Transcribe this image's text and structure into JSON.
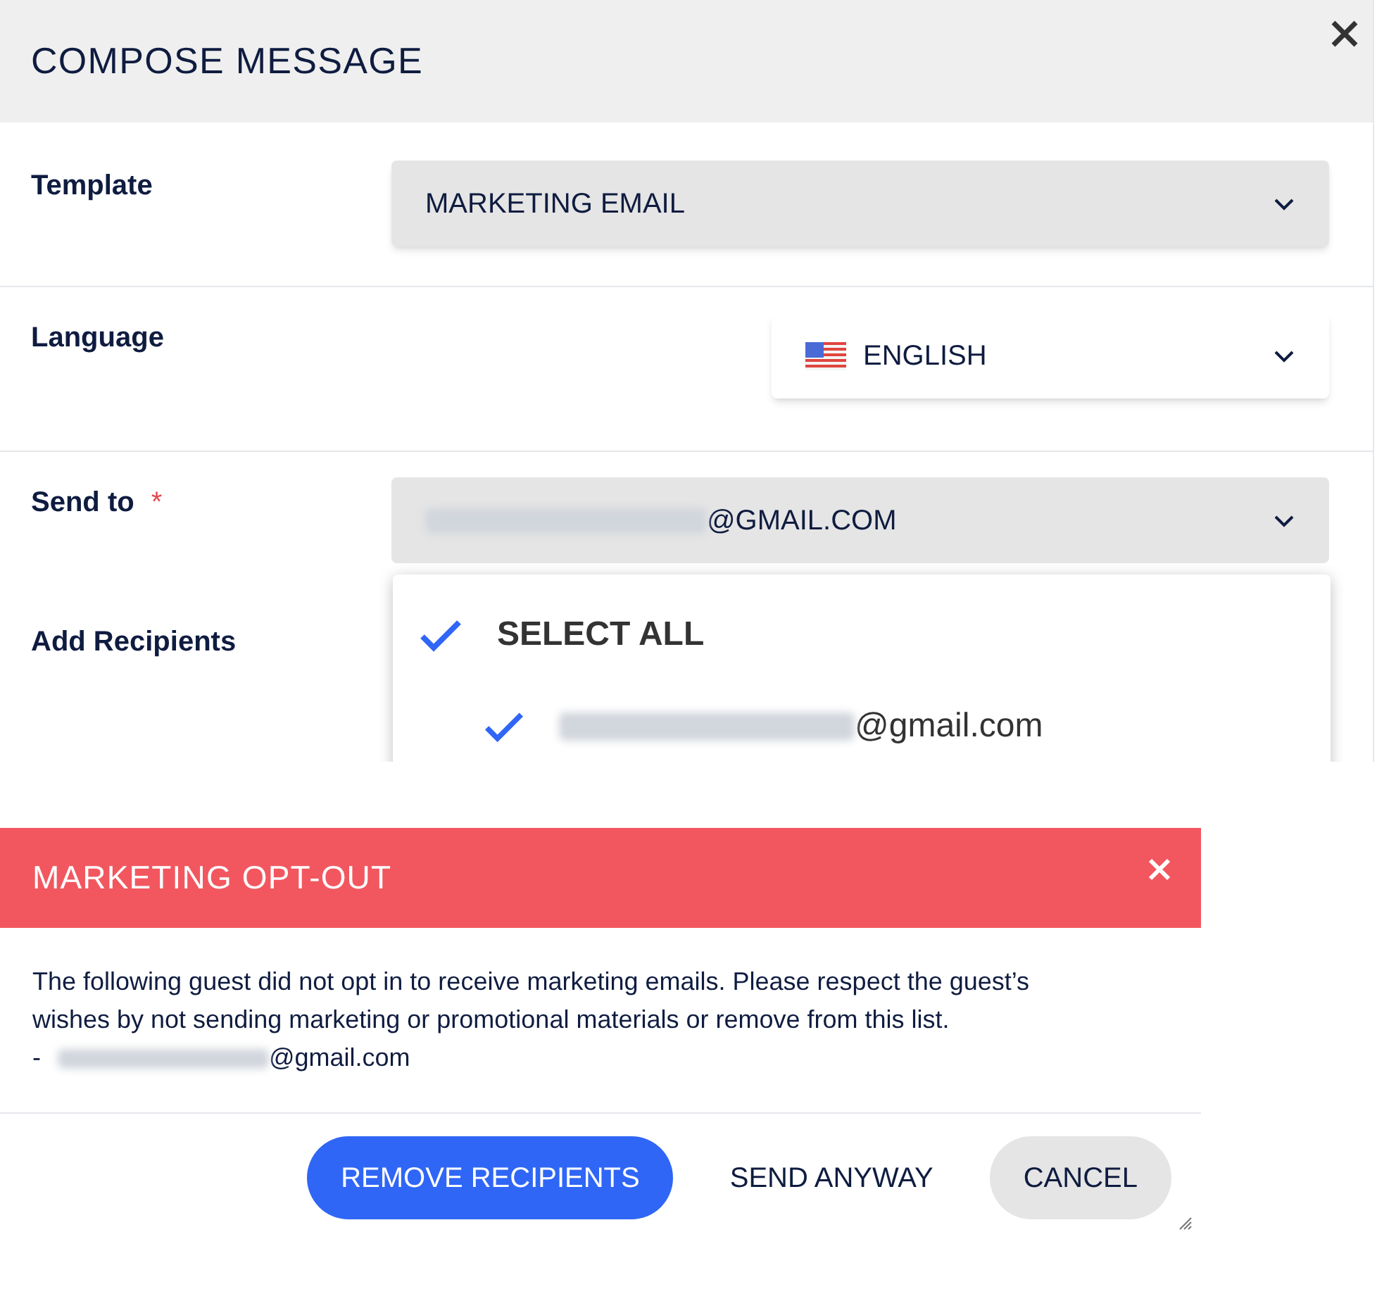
{
  "compose": {
    "title": "COMPOSE MESSAGE",
    "fields": [
      {
        "label": "Template",
        "kind": "select",
        "value": "MARKETING EMAIL"
      },
      {
        "label": "Language",
        "kind": "language",
        "value": "ENGLISH"
      },
      {
        "label": "Send to",
        "kind": "recipients",
        "required": true,
        "required_mark": "*",
        "value": "@GMAIL.COM",
        "redacted": true
      }
    ],
    "add_recipients_label": "Add Recipients",
    "dropdown": [
      {
        "label": "SELECT ALL",
        "kind": "all",
        "checked": true
      },
      {
        "label": "@gmail.com",
        "kind": "email",
        "checked": true,
        "redacted": true
      }
    ]
  },
  "alert": {
    "title": "MARKETING OPT-OUT",
    "message": "The following guest did not opt in to receive marketing emails. Please respect the guest’s wishes by not sending marketing or promotional materials or remove from this list.",
    "email_prefix": "-",
    "email": "@gmail.com",
    "redacted": true,
    "buttons": [
      {
        "label": "REMOVE RECIPIENTS",
        "kind": "primary"
      },
      {
        "label": "SEND ANYWAY",
        "kind": "text"
      },
      {
        "label": "CANCEL",
        "kind": "secondary"
      }
    ]
  }
}
